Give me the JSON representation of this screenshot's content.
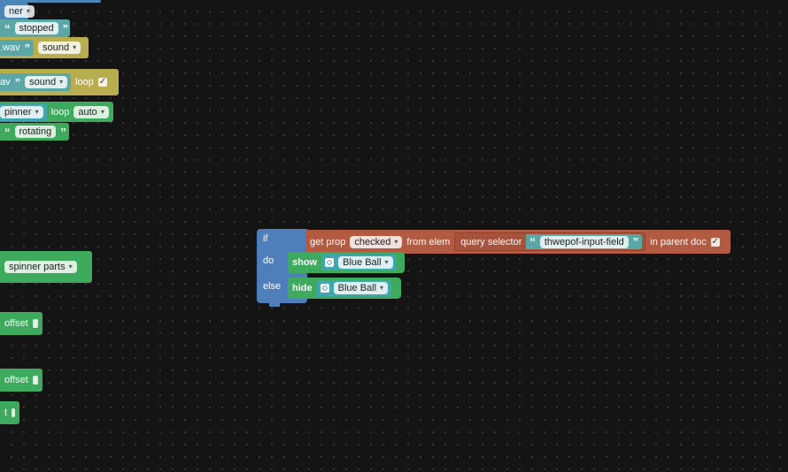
{
  "left_blocks": {
    "row1": {
      "dropdown": "ner"
    },
    "row2": {
      "text": "stopped"
    },
    "row3": {
      "text": ".wav",
      "dropdown": "sound"
    },
    "row4": {
      "text": "av",
      "dropdown": "sound",
      "loop_label": "loop",
      "loop_checked": true
    },
    "row5": {
      "dropdown": "pinner",
      "loop_label": "loop",
      "loop_value": "auto"
    },
    "row6": {
      "text": "rotating"
    },
    "row7": {
      "dropdown": "spinner parts"
    },
    "row8": {
      "label": "offset"
    },
    "row9": {
      "label": "offset"
    },
    "row10": {
      "label": "t"
    }
  },
  "if_block": {
    "if_label": "if",
    "do_label": "do",
    "else_label": "else",
    "condition": {
      "get_prop_label": "get prop",
      "prop_value": "checked",
      "from_elem_label": "from elem",
      "query_selector_label": "query selector",
      "selector_text": "thwepof-input-field",
      "in_parent_doc_label": "in parent doc",
      "in_parent_doc_checked": true
    },
    "do_action": {
      "verb": "show",
      "target": "Blue Ball"
    },
    "else_action": {
      "verb": "hide",
      "target": "Blue Ball"
    }
  },
  "quote_open": "“",
  "quote_close": "”",
  "colors": {
    "workspace": "#141414",
    "text_block": "#5ba6a6",
    "sound_block": "#b8ae4f",
    "logic_block": "#4f7fba",
    "html_block": "#b35a43",
    "action_block": "#3eaa5e",
    "object_block": "#3fa6b0"
  }
}
